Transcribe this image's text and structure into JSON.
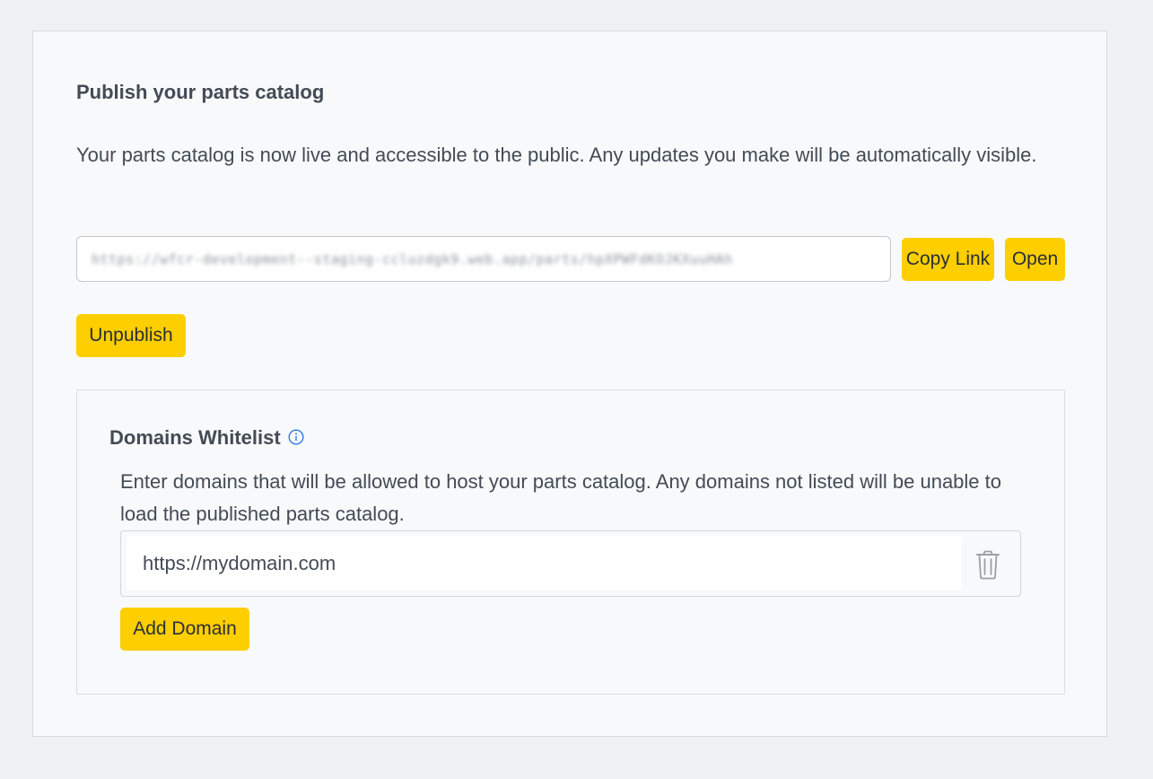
{
  "publish": {
    "title": "Publish your parts catalog",
    "description": "Your parts catalog is now live and accessible to the public. Any updates you make will be automatically visible.",
    "url_value": "https://wfcr-development--staging-ccluzdgk9.web.app/parts/hpXPWFdKOJKXuuHAh",
    "copy_link_label": "Copy Link",
    "open_label": "Open",
    "unpublish_label": "Unpublish"
  },
  "whitelist": {
    "title": "Domains Whitelist",
    "info_icon": "info-circle-icon",
    "description": "Enter domains that will be allowed to host your parts catalog. Any domains not listed will be unable to load the published parts catalog.",
    "domains": [
      {
        "value": "https://mydomain.com",
        "delete_icon": "trash-icon"
      }
    ],
    "add_domain_label": "Add Domain"
  },
  "colors": {
    "accent": "#fdce00",
    "info_icon": "#2f7be5",
    "text": "#434b55",
    "background": "#f0f1f4"
  }
}
